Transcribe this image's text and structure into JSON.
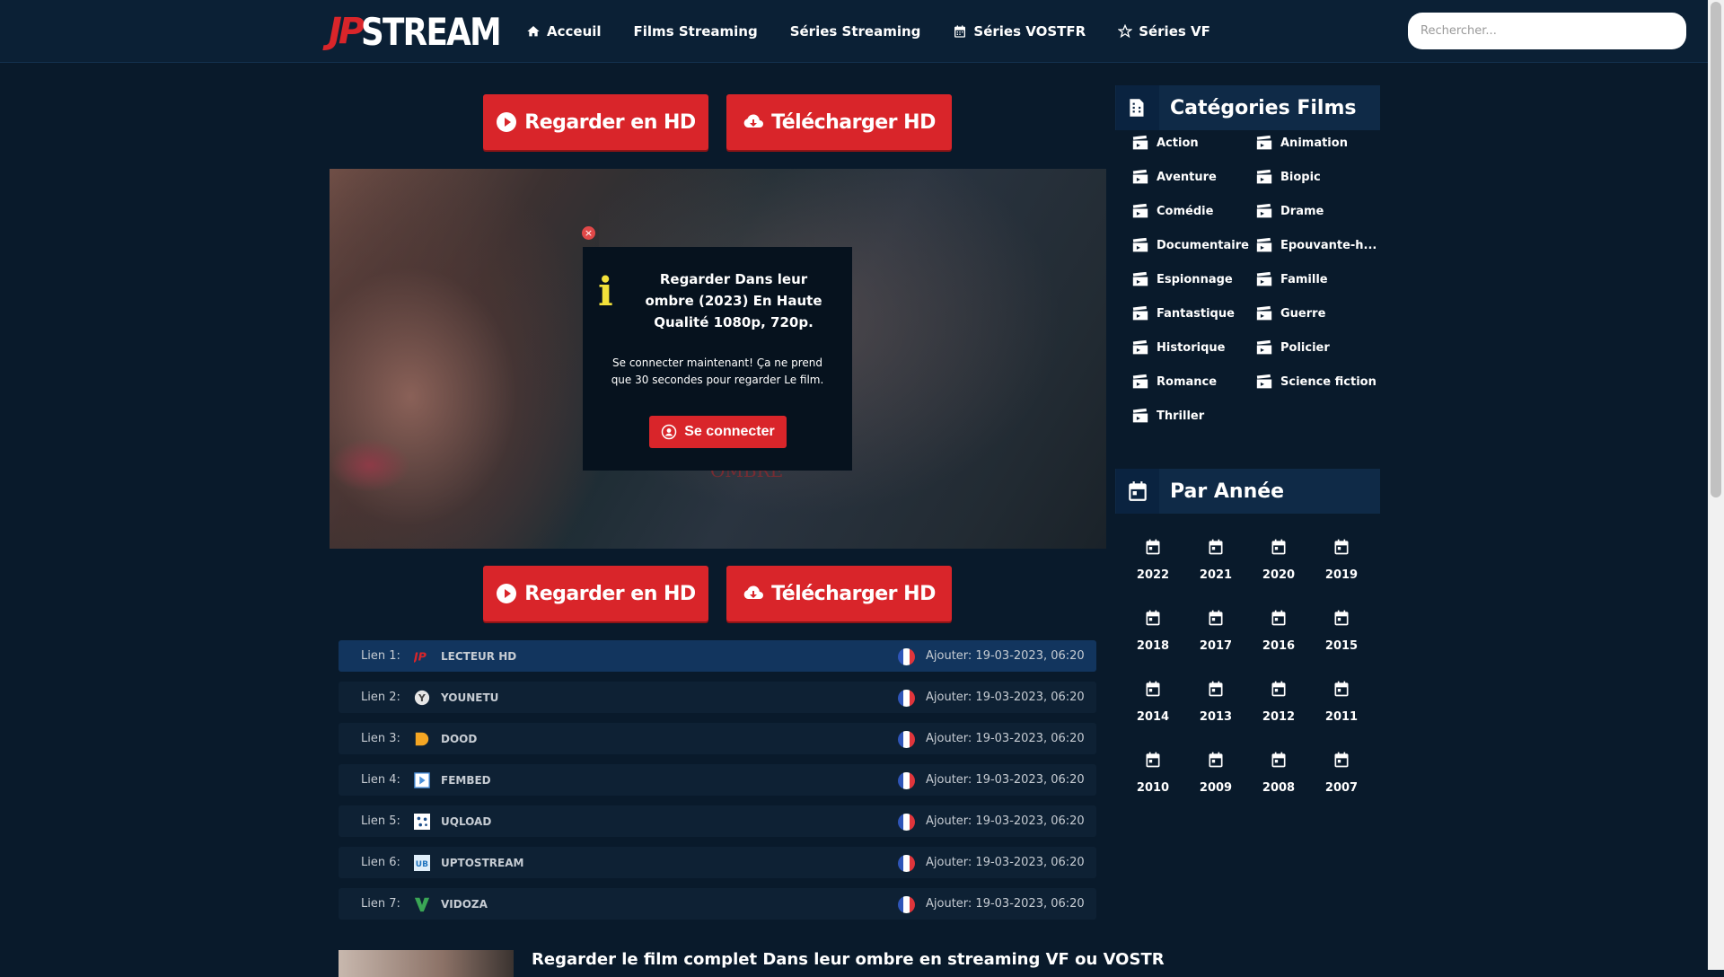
{
  "header": {
    "logo_mark": "JP",
    "logo_text": "STREAM",
    "nav": [
      {
        "label": "Acceuil",
        "icon": "home-icon"
      },
      {
        "label": "Films Streaming",
        "icon": ""
      },
      {
        "label": "Séries Streaming",
        "icon": ""
      },
      {
        "label": "Séries VOSTFR",
        "icon": "calendar-icon"
      },
      {
        "label": "Séries VF",
        "icon": "star-icon"
      }
    ],
    "search_placeholder": "Rechercher..."
  },
  "actions": {
    "watch_label": "Regarder en HD",
    "download_label": "Télécharger HD"
  },
  "player": {
    "title_ghost": "OMBRE"
  },
  "popup": {
    "close": "×",
    "icon": "i",
    "title": "Regarder Dans leur ombre (2023) En Haute Qualité 1080p, 720p.",
    "subtitle": "Se connecter maintenant! Ça ne prend que 30 secondes pour regarder Le film.",
    "button_label": "Se connecter"
  },
  "links": [
    {
      "num": "Lien 1:",
      "name": "LECTEUR HD",
      "date": "Ajouter: 19-03-2023, 06:20",
      "icon": "jp-icon",
      "active": true
    },
    {
      "num": "Lien 2:",
      "name": "YOUNETU",
      "date": "Ajouter: 19-03-2023, 06:20",
      "icon": "younetu-icon",
      "active": false
    },
    {
      "num": "Lien 3:",
      "name": "DOOD",
      "date": "Ajouter: 19-03-2023, 06:20",
      "icon": "dood-icon",
      "active": false
    },
    {
      "num": "Lien 4:",
      "name": "FEMBED",
      "date": "Ajouter: 19-03-2023, 06:20",
      "icon": "fembed-icon",
      "active": false
    },
    {
      "num": "Lien 5:",
      "name": "UQLOAD",
      "date": "Ajouter: 19-03-2023, 06:20",
      "icon": "uqload-icon",
      "active": false
    },
    {
      "num": "Lien 6:",
      "name": "UPTOSTREAM",
      "date": "Ajouter: 19-03-2023, 06:20",
      "icon": "uptostream-icon",
      "active": false
    },
    {
      "num": "Lien 7:",
      "name": "VIDOZA",
      "date": "Ajouter: 19-03-2023, 06:20",
      "icon": "vidoza-icon",
      "active": false
    }
  ],
  "bottom": {
    "title": "Regarder le film complet Dans leur ombre en streaming VF ou VOSTR"
  },
  "sidebar": {
    "categories_title": "Catégories Films",
    "categories": [
      "Action",
      "Animation",
      "Aventure",
      "Biopic",
      "Comédie",
      "Drame",
      "Documentaire",
      "Epouvante-h...",
      "Espionnage",
      "Famille",
      "Fantastique",
      "Guerre",
      "Historique",
      "Policier",
      "Romance",
      "Science fiction",
      "Thriller"
    ],
    "years_title": "Par Année",
    "years": [
      "2022",
      "2021",
      "2020",
      "2019",
      "2018",
      "2017",
      "2016",
      "2015",
      "2014",
      "2013",
      "2012",
      "2011",
      "2010",
      "2009",
      "2008",
      "2007"
    ]
  },
  "colors": {
    "accent": "#d9252a",
    "background": "#091a2b",
    "header": "#0b2035",
    "sidebar_head": "#0f2a47"
  }
}
